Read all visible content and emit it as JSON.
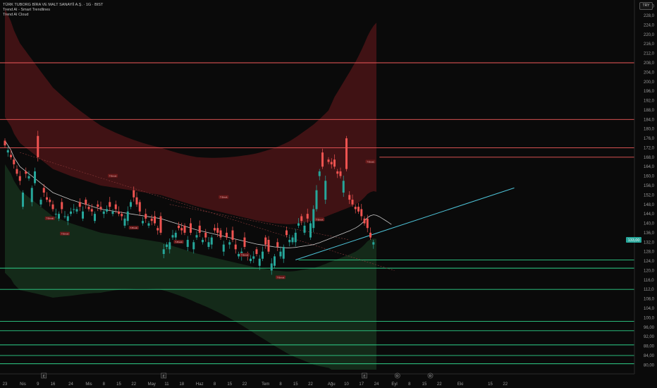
{
  "header": {
    "symbol_line": "TÜRK TUBORG BİRA VE MALT SANAYİİ A.Ş. · 1G · BIST",
    "indicators": [
      "Trend AI - Smart Trendlines",
      "Trend AI Cloud"
    ],
    "currency": "TRY"
  },
  "colors": {
    "background": "#0a0a0a",
    "bull": "#26a69a",
    "bear": "#ef5350",
    "resistance": "#f05a5a",
    "support": "#2fd28a",
    "cloud_top": "#4a1416",
    "cloud_bottom": "#16301c",
    "trendline": "#4ec3d8",
    "ma": "#c8c8c8"
  },
  "chart_data": {
    "type": "candlestick",
    "ylim": [
      78,
      234
    ],
    "y_ticks": [
      "80,00",
      "84,00",
      "88,00",
      "92,00",
      "96,00",
      "100,0",
      "104,0",
      "108,0",
      "112,0",
      "116,0",
      "120,0",
      "124,0",
      "128,0",
      "132,0",
      "136,0",
      "140,0",
      "144,0",
      "148,0",
      "152,0",
      "156,0",
      "160,0",
      "164,0",
      "168,0",
      "172,0",
      "176,0",
      "180,0",
      "184,0",
      "188,0",
      "192,0",
      "196,0",
      "200,0",
      "204,0",
      "208,0",
      "212,0",
      "216,0",
      "220,0",
      "224,0",
      "228,0",
      "232,0"
    ],
    "x_ticks": [
      {
        "label": "23",
        "i": 0
      },
      {
        "label": "Nis",
        "i": 6
      },
      {
        "label": "9",
        "i": 11
      },
      {
        "label": "16",
        "i": 16
      },
      {
        "label": "24",
        "i": 22
      },
      {
        "label": "Mis",
        "i": 28
      },
      {
        "label": "8",
        "i": 33
      },
      {
        "label": "15",
        "i": 38
      },
      {
        "label": "22",
        "i": 43
      },
      {
        "label": "May",
        "i": 49
      },
      {
        "label": "11",
        "i": 54
      },
      {
        "label": "18",
        "i": 59
      },
      {
        "label": "Haz",
        "i": 65
      },
      {
        "label": "8",
        "i": 70
      },
      {
        "label": "15",
        "i": 75
      },
      {
        "label": "22",
        "i": 80
      },
      {
        "label": "Tem",
        "i": 87
      },
      {
        "label": "8",
        "i": 92
      },
      {
        "label": "15",
        "i": 97
      },
      {
        "label": "22",
        "i": 102
      },
      {
        "label": "Ağu",
        "i": 109
      },
      {
        "label": "10",
        "i": 114
      },
      {
        "label": "17",
        "i": 119
      },
      {
        "label": "24",
        "i": 124
      },
      {
        "label": "Eyl",
        "i": 130
      },
      {
        "label": "8",
        "i": 135
      },
      {
        "label": "15",
        "i": 140
      },
      {
        "label": "22",
        "i": 145
      },
      {
        "label": "Eki",
        "i": 152
      },
      {
        "label": "15",
        "i": 162
      },
      {
        "label": "22",
        "i": 167
      }
    ],
    "x_markers": [
      {
        "type": "E",
        "i": 13
      },
      {
        "type": "E",
        "i": 53
      },
      {
        "type": "E",
        "i": 120
      },
      {
        "type": "D",
        "i": 131
      },
      {
        "type": "D",
        "i": 142
      }
    ],
    "closes": [
      173,
      171,
      168,
      165,
      161,
      158,
      153,
      161,
      160,
      155,
      162,
      168,
      150,
      153,
      150,
      149,
      146,
      144,
      144,
      146,
      143,
      143,
      145,
      146,
      146,
      147,
      145,
      148,
      146,
      145,
      144,
      147,
      146,
      145,
      146,
      147,
      145,
      146,
      144,
      143,
      142,
      145,
      149,
      151,
      148,
      145,
      141,
      142,
      140,
      141,
      140,
      137,
      136,
      129,
      131,
      132,
      135,
      136,
      138,
      137,
      136,
      133,
      136,
      132,
      135,
      136,
      133,
      134,
      132,
      134,
      137,
      136,
      134,
      131,
      134,
      132,
      133,
      129,
      127,
      128,
      130,
      126,
      125,
      126,
      127,
      125,
      128,
      131,
      128,
      123,
      126,
      130,
      128,
      130,
      135,
      133,
      134,
      136,
      140,
      141,
      139,
      142,
      140,
      146,
      154,
      162,
      164,
      158,
      166,
      165,
      164,
      161,
      160,
      158,
      163,
      150,
      148,
      146,
      145,
      143,
      140,
      138,
      134,
      132,
      133
    ],
    "open_diffs": [
      2,
      -1,
      1,
      2,
      2,
      2,
      -6,
      1,
      -1,
      -6,
      -5,
      9,
      -2,
      2,
      1,
      1,
      2,
      0,
      -2,
      3,
      0,
      -2,
      -1,
      0,
      -1,
      2,
      -3,
      2,
      1,
      1,
      -3,
      1,
      1,
      -1,
      -1,
      2,
      -1,
      2,
      1,
      1,
      -3,
      -4,
      -2,
      3,
      3,
      4,
      -1,
      2,
      -1,
      1,
      3,
      1,
      7,
      -2,
      -1,
      -3,
      -1,
      -2,
      1,
      1,
      3,
      -3,
      4,
      -3,
      -1,
      3,
      -1,
      2,
      -2,
      -3,
      1,
      2,
      3,
      -3,
      2,
      -1,
      4,
      2,
      -1,
      -2,
      4,
      1,
      -1,
      -1,
      2,
      -3,
      -3,
      3,
      5,
      -3,
      -4,
      2,
      -2,
      -5,
      2,
      -1,
      -2,
      -4,
      -1,
      2,
      -3,
      2,
      -6,
      -8,
      -8,
      -2,
      6,
      -8,
      1,
      1,
      3,
      1,
      2,
      -5,
      13,
      2,
      2,
      1,
      2,
      3,
      2,
      4,
      2,
      -1
    ],
    "current_price": "133,00",
    "resistance_levels": [
      208,
      184,
      172,
      168
    ],
    "support_levels": [
      124.5,
      121,
      112,
      98.5,
      94.5,
      88.5,
      84,
      80.5
    ],
    "ma_values": [
      175,
      173,
      171,
      168,
      166,
      164,
      163,
      162,
      161,
      160,
      159,
      158,
      157,
      156,
      155,
      154,
      153,
      152.5,
      152,
      151.5,
      151,
      150.5,
      150,
      149.6,
      149.2,
      148.8,
      148.4,
      148,
      147.6,
      147.2,
      146.8,
      146.4,
      146,
      145.8,
      145.6,
      145.4,
      145.2,
      145,
      144.8,
      144.6,
      144.4,
      144.2,
      144,
      143.8,
      143.6,
      143.4,
      143.2,
      143,
      142.8,
      142.6,
      142.4,
      142.2,
      142,
      141.6,
      141.2,
      140.8,
      140.4,
      140,
      139.6,
      139.2,
      138.8,
      138.4,
      138,
      137.6,
      137.2,
      136.9,
      136.6,
      136.3,
      136,
      135.7,
      135.4,
      135.1,
      134.8,
      134.5,
      134.2,
      133.9,
      133.6,
      133.3,
      133,
      132.7,
      132.4,
      132.1,
      131.8,
      131.5,
      131.2,
      131,
      130.8,
      130.6,
      130.4,
      130.2,
      130,
      129.9,
      129.8,
      129.7,
      129.6,
      129.6,
      129.7,
      129.8,
      130,
      130.2,
      130.4,
      130.6,
      130.8,
      131,
      131.4,
      131.8,
      132.3,
      132.8,
      133.3,
      133.8,
      134.3,
      134.8,
      135.3,
      135.8,
      136.3,
      136.8,
      137.4,
      138,
      138.8,
      139.8,
      141,
      142.4,
      143.2,
      143.6,
      143.4,
      142.8,
      142,
      141.2,
      140.4,
      139.5
    ],
    "trendline": [
      [
        97,
        124.5
      ],
      [
        170,
        155
      ]
    ],
    "dashed_trend_1": [
      [
        5,
        170
      ],
      [
        130,
        120
      ]
    ],
    "dashed_trend_2": [
      [
        55,
        148
      ],
      [
        115,
        133
      ]
    ],
    "annotations": [
      {
        "text": "T-Break",
        "i": 36,
        "y": 160
      },
      {
        "text": "T-Break",
        "i": 73,
        "y": 151
      },
      {
        "text": "T-Break",
        "i": 15,
        "y": 142
      },
      {
        "text": "T-Break",
        "i": 43,
        "y": 138
      },
      {
        "text": "T-Break",
        "i": 20,
        "y": 135.5
      },
      {
        "text": "T-Break",
        "i": 58,
        "y": 132
      },
      {
        "text": "T-Break",
        "i": 80,
        "y": 126.5
      },
      {
        "text": "T-Break",
        "i": 92,
        "y": 117
      },
      {
        "text": "T-Break",
        "i": 105,
        "y": 141.5
      },
      {
        "text": "T-Break",
        "i": 122,
        "y": 166
      }
    ]
  }
}
